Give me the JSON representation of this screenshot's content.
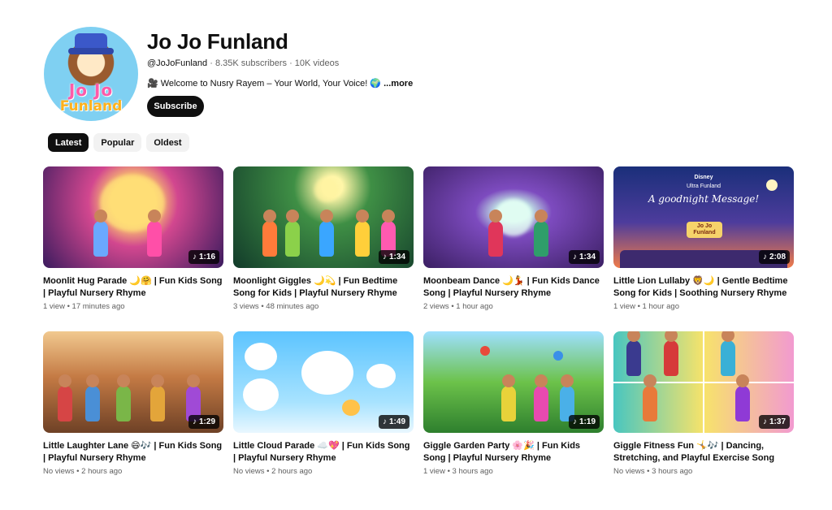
{
  "channel": {
    "name": "Jo Jo Funland",
    "avatar_text_line1": "Jo Jo",
    "avatar_text_line2": "Funland",
    "handle": "@JoJoFunland",
    "subscribers": "8.35K subscribers",
    "videos": "10K videos",
    "description": "🎥 Welcome to Nusry Rayem – Your World, Your Voice! 🌍",
    "more_label": "...more",
    "subscribe_label": "Subscribe"
  },
  "filters": [
    {
      "label": "Latest",
      "active": true
    },
    {
      "label": "Popular",
      "active": false
    },
    {
      "label": "Oldest",
      "active": false
    }
  ],
  "videos": [
    {
      "title": "Moonlit Hug Parade 🌙🤗 | Fun Kids Song | Playful Nursery Rhyme",
      "views": "1 view",
      "age": "17 minutes ago",
      "duration": "1:16"
    },
    {
      "title": "Moonlight Giggles 🌙💫 | Fun Bedtime Song for Kids | Playful Nursery Rhyme",
      "views": "3 views",
      "age": "48 minutes ago",
      "duration": "1:34"
    },
    {
      "title": "Moonbeam Dance 🌙💃 | Fun Kids Dance Song | Playful Nursery Rhyme",
      "views": "2 views",
      "age": "1 hour ago",
      "duration": "1:34"
    },
    {
      "title": "Little Lion Lullaby 🦁🌙 | Gentle Bedtime Song for Kids | Soothing Nursery Rhyme",
      "views": "1 view",
      "age": "1 hour ago",
      "duration": "2:08"
    },
    {
      "title": "Little Laughter Lane 😄🎶 | Fun Kids Song | Playful Nursery Rhyme",
      "views": "No views",
      "age": "2 hours ago",
      "duration": "1:29"
    },
    {
      "title": "Little Cloud Parade ☁️💖 | Fun Kids Song | Playful Nursery Rhyme",
      "views": "No views",
      "age": "2 hours ago",
      "duration": "1:49"
    },
    {
      "title": "Giggle Garden Party 🌸🎉 | Fun Kids Song | Playful Nursery Rhyme",
      "views": "1 view",
      "age": "3 hours ago",
      "duration": "1:19"
    },
    {
      "title": "Giggle Fitness Fun 🤸🎶 | Dancing, Stretching, and Playful Exercise Song for...",
      "views": "No views",
      "age": "3 hours ago",
      "duration": "1:37"
    }
  ],
  "thumbnail_overlay_text": {
    "brand": "Disney",
    "line1": "Ultra Funland",
    "line2": "A goodnight Message!",
    "sign": "Jo Jo Funland"
  },
  "icons": {
    "duration": "music-note-icon"
  }
}
